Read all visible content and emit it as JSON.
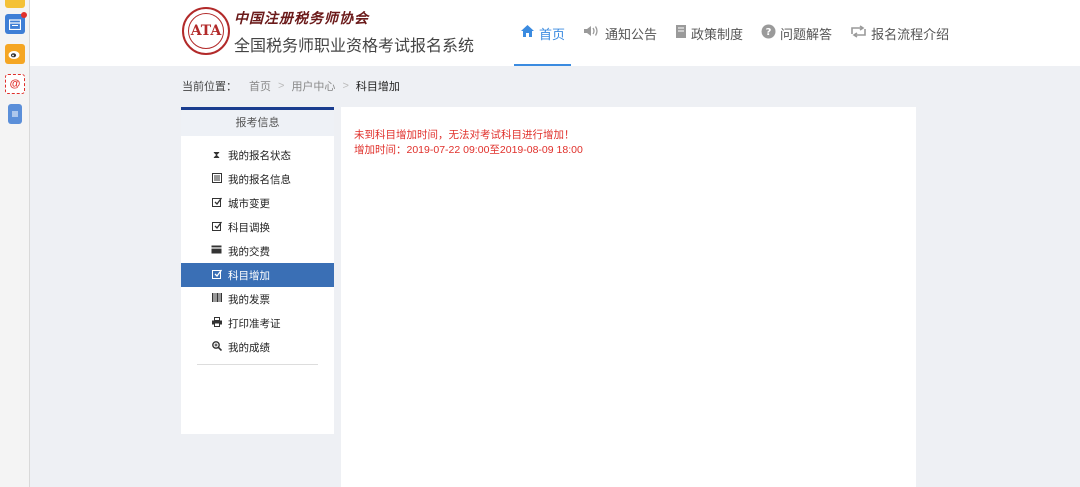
{
  "strip": {
    "icons": [
      "app-icon",
      "calendar-icon",
      "weibo-icon",
      "at-icon",
      "document-icon"
    ],
    "at_glyph": "@"
  },
  "header": {
    "org_name": "中国注册税务师协会",
    "system_name": "全国税务师职业资格考试报名系统",
    "logo_text": "ATA"
  },
  "nav": [
    {
      "label": "首页",
      "icon": "home-icon",
      "active": true
    },
    {
      "label": "通知公告",
      "icon": "speaker-icon",
      "active": false
    },
    {
      "label": "政策制度",
      "icon": "book-icon",
      "active": false
    },
    {
      "label": "问题解答",
      "icon": "question-icon",
      "active": false
    },
    {
      "label": "报名流程介绍",
      "icon": "refresh-icon",
      "active": false
    }
  ],
  "breadcrumb": {
    "label": "当前位置：",
    "items": [
      "首页",
      "用户中心",
      "科目增加"
    ]
  },
  "side": {
    "title": "报考信息",
    "items": [
      {
        "label": "我的报名状态",
        "icon": "hourglass-icon",
        "active": false
      },
      {
        "label": "我的报名信息",
        "icon": "list-icon",
        "active": false
      },
      {
        "label": "城市变更",
        "icon": "edit-icon",
        "active": false
      },
      {
        "label": "科目调换",
        "icon": "edit-icon",
        "active": false
      },
      {
        "label": "我的交费",
        "icon": "credit-card-icon",
        "active": false
      },
      {
        "label": "科目增加",
        "icon": "edit-icon",
        "active": true
      },
      {
        "label": "我的发票",
        "icon": "barcode-icon",
        "active": false
      },
      {
        "label": "打印准考证",
        "icon": "print-icon",
        "active": false
      },
      {
        "label": "我的成绩",
        "icon": "zoom-icon",
        "active": false
      }
    ]
  },
  "main": {
    "message_line1": "未到科目增加时间，无法对考试科目进行增加！",
    "message_line2": "增加时间：2019-07-22 09:00至2019-08-09 18:00"
  }
}
